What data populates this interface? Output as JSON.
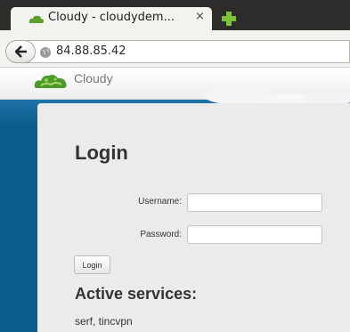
{
  "browser": {
    "tab": {
      "title": "Cloudy - cloudydem...",
      "close_glyph": "×"
    },
    "new_tab_icon": "plus-icon",
    "address": {
      "url": "84.88.85.42",
      "security_icon": "globe-icon"
    },
    "back_icon": "arrow-left-icon"
  },
  "site": {
    "brand": "Cloudy",
    "logo_icon": "cloud-logo-icon",
    "colors": {
      "background": "#0b5b8b",
      "panel": "#ebebeb",
      "tab_strip": "#2c2c2a",
      "favicon_green": "#5aa02c"
    }
  },
  "login": {
    "heading": "Login",
    "username_label": "Username:",
    "username_value": "",
    "password_label": "Password:",
    "password_value": "",
    "submit_label": "Login"
  },
  "services": {
    "heading": "Active services:",
    "list": "serf, tincvpn"
  }
}
